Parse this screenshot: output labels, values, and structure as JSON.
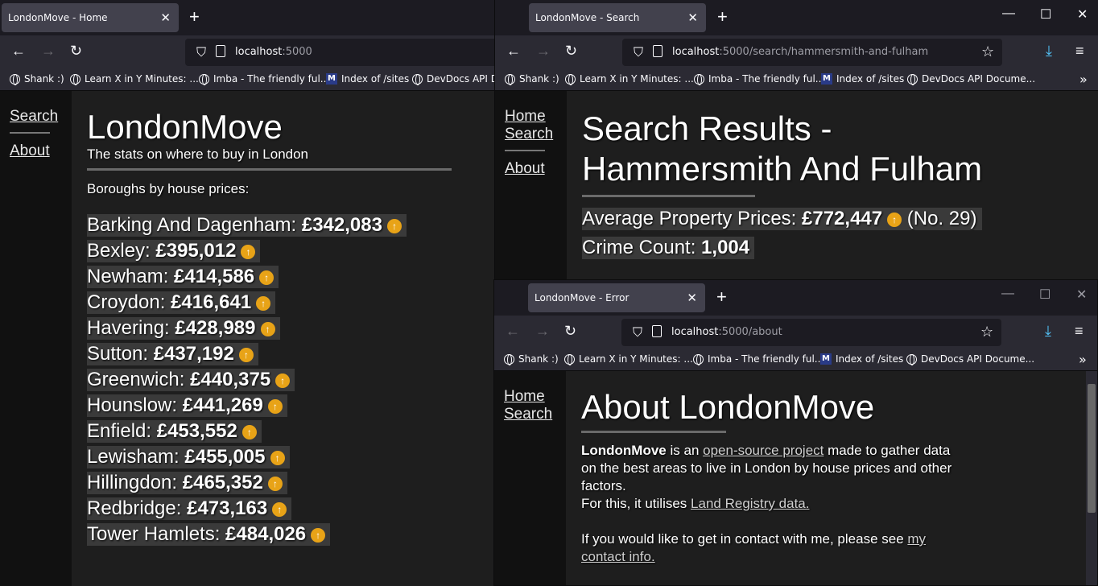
{
  "left_window": {
    "tab_title": "LondonMove - Home",
    "url_host": "localhost",
    "url_rest": ":5000",
    "bookmarks": [
      "Shank :)",
      "Learn X in Y Minutes: ...",
      "Imba - The friendly ful...",
      "Index of /sites",
      "DevDocs API D"
    ],
    "sidebar": {
      "search": "Search",
      "about": "About"
    },
    "page": {
      "title": "LondonMove",
      "subtitle": "The stats on where to buy in London",
      "section": "Boroughs by house prices:",
      "boroughs": [
        {
          "name": "Barking And Dagenham:",
          "price": "£342,083"
        },
        {
          "name": "Bexley:",
          "price": "£395,012"
        },
        {
          "name": "Newham:",
          "price": "£414,586"
        },
        {
          "name": "Croydon:",
          "price": "£416,641"
        },
        {
          "name": "Havering:",
          "price": "£428,989"
        },
        {
          "name": "Sutton:",
          "price": "£437,192"
        },
        {
          "name": "Greenwich:",
          "price": "£440,375"
        },
        {
          "name": "Hounslow:",
          "price": "£441,269"
        },
        {
          "name": "Enfield:",
          "price": "£453,552"
        },
        {
          "name": "Lewisham:",
          "price": "£455,005"
        },
        {
          "name": "Hillingdon:",
          "price": "£465,352"
        },
        {
          "name": "Redbridge:",
          "price": "£473,163"
        },
        {
          "name": "Tower Hamlets:",
          "price": "£484,026"
        }
      ]
    }
  },
  "right_top_window": {
    "tab_title": "LondonMove - Search",
    "url_host": "localhost",
    "url_rest": ":5000/search/hammersmith-and-fulham",
    "bookmarks": [
      "Shank :)",
      "Learn X in Y Minutes: ...",
      "Imba - The friendly ful...",
      "Index of /sites",
      "DevDocs API Docume..."
    ],
    "sidebar": {
      "home": "Home",
      "search": "Search",
      "about": "About"
    },
    "page": {
      "title_line1": "Search Results -",
      "title_line2": "Hammersmith And Fulham",
      "avg_label": "Average Property Prices:",
      "avg_value": "£772,447",
      "rank": "(No. 29)",
      "crime_label": "Crime Count:",
      "crime_value": "1,004"
    }
  },
  "right_bottom_window": {
    "tab_title": "LondonMove - Error",
    "url_host": "localhost",
    "url_rest": ":5000/about",
    "bookmarks": [
      "Shank :)",
      "Learn X in Y Minutes: ...",
      "Imba - The friendly ful...",
      "Index of /sites",
      "DevDocs API Docume..."
    ],
    "sidebar": {
      "home": "Home",
      "search": "Search"
    },
    "page": {
      "title": "About LondonMove",
      "brand": "LondonMove",
      "p1_a": " is an ",
      "p1_link": "open-source project",
      "p1_b": " made to gather data on the best areas to live in London by house prices and other factors.",
      "p2_a": "For this, it utilises ",
      "p2_link": "Land Registry data.",
      "p3_a": "If you would like to get in contact with me, please see ",
      "p3_link": "my contact info."
    }
  },
  "icons": {
    "coin": "↑"
  }
}
